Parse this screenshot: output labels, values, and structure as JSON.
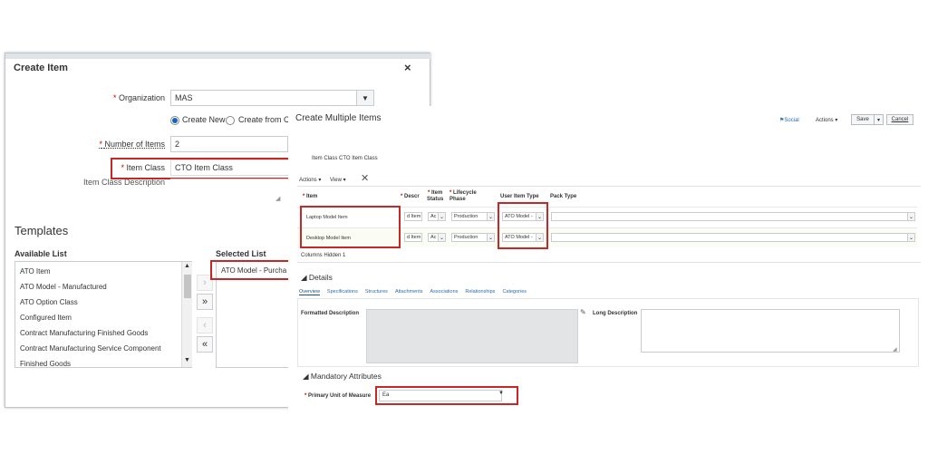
{
  "create_item": {
    "title": "Create Item",
    "close": "×",
    "organization": {
      "label": "Organization",
      "value": "MAS"
    },
    "create_mode": {
      "option_new": "Create New",
      "option_from": "Create from C"
    },
    "number_of_items": {
      "label": "Number of Items",
      "value": "2"
    },
    "item_class": {
      "label": "Item Class",
      "value": "CTO Item Class"
    },
    "item_class_description": {
      "label": "Item Class Description"
    },
    "templates": {
      "heading": "Templates",
      "available_label": "Available List",
      "selected_label": "Selected List",
      "available": [
        "ATO Item",
        "ATO Model - Manufactured",
        "ATO Option Class",
        "Configured Item",
        "Contract Manufacturing Finished Goods",
        "Contract Manufacturing Service Component",
        "Finished Goods"
      ],
      "selected": [
        "ATO Model - Purcha"
      ],
      "move_all": "»",
      "remove_all": "«"
    }
  },
  "multiple_items": {
    "title": "Create Multiple Items",
    "top_links": {
      "social": "Social",
      "actions": "Actions",
      "save": "Save",
      "cancel": "Cancel"
    },
    "item_class_line": "Item Class  CTO Item Class",
    "toolbar": {
      "actions": "Actions",
      "view": "View"
    },
    "columns": {
      "item": "Item",
      "description": "Descr",
      "item_status_1": "Item",
      "item_status_2": "Status",
      "lifecycle_1": "Lifecycle",
      "lifecycle_2": "Phase",
      "user_item_type": "User Item Type",
      "pack_type": "Pack Type"
    },
    "rows": [
      {
        "item": "Laptop Model Item",
        "description": "d Item",
        "status": "Ac",
        "phase": "Production",
        "user_item_type": "ATO Model -"
      },
      {
        "item": "Desktop Model Item",
        "description": "d Item",
        "status": "Ac",
        "phase": "Production",
        "user_item_type": "ATO Model -"
      }
    ],
    "columns_hidden": "Columns Hidden  1",
    "details": {
      "heading": "Details",
      "tabs": [
        "Overview",
        "Specifications",
        "Structures",
        "Attachments",
        "Associations",
        "Relationships",
        "Categories"
      ],
      "formatted_description": "Formatted Description",
      "long_description": "Long Description"
    },
    "mandatory": {
      "heading": "Mandatory Attributes",
      "primary_uom_label": "Primary Unit of Measure",
      "primary_uom_value": "Ea"
    }
  },
  "colors": {
    "highlight": "#c62828",
    "link": "#2a6db0",
    "radio": "#1565c0"
  }
}
